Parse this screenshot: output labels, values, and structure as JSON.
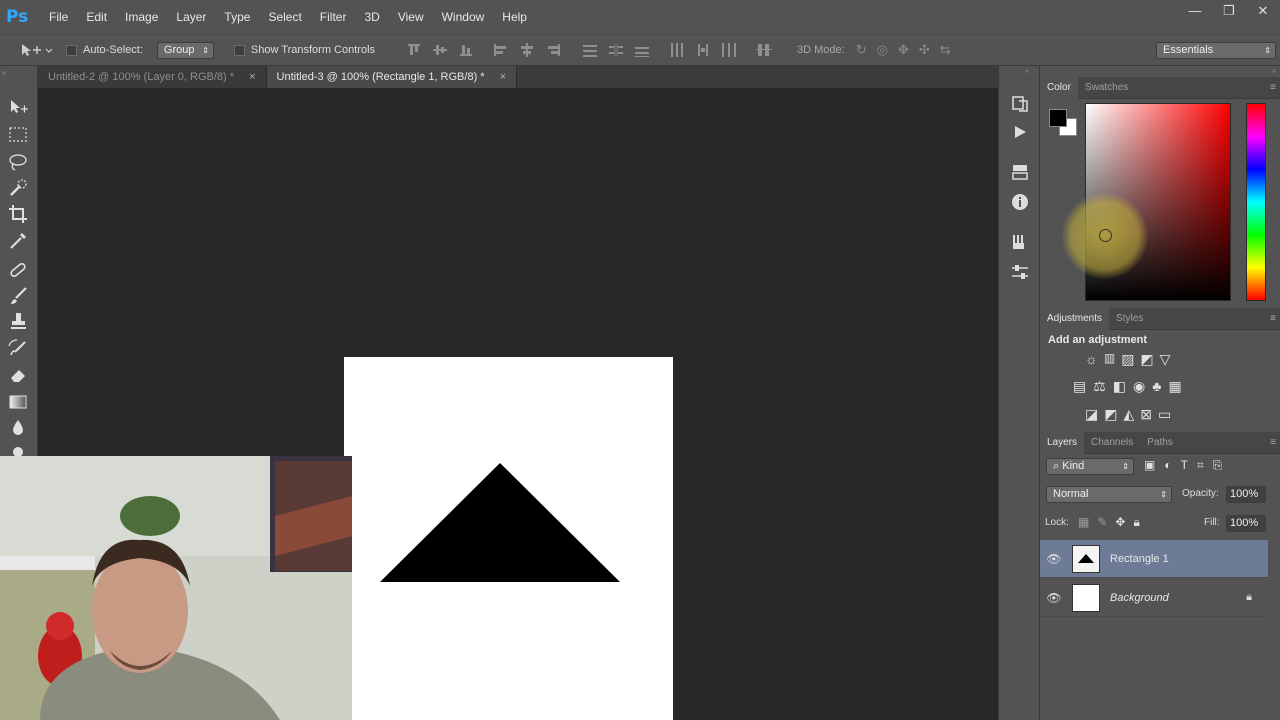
{
  "app": {
    "logo": "Ps"
  },
  "menu": [
    "File",
    "Edit",
    "Image",
    "Layer",
    "Type",
    "Select",
    "Filter",
    "3D",
    "View",
    "Window",
    "Help"
  ],
  "window_controls": {
    "minimize": "—",
    "restore": "❐",
    "close": "✕"
  },
  "options": {
    "auto_select_label": "Auto-Select:",
    "auto_select_value": "Group",
    "transform_label": "Show Transform Controls",
    "mode_3d_label": "3D Mode:",
    "workspace": "Essentials"
  },
  "tabs": [
    {
      "label": "Untitled-2 @ 100% (Layer 0, RGB/8) *",
      "close": "×"
    },
    {
      "label": "Untitled-3 @ 100% (Rectangle 1, RGB/8) *",
      "close": "×"
    }
  ],
  "color_panel": {
    "tabs": [
      "Color",
      "Swatches"
    ]
  },
  "adjustments_panel": {
    "tabs": [
      "Adjustments",
      "Styles"
    ],
    "heading": "Add an adjustment"
  },
  "layers_panel": {
    "tabs": [
      "Layers",
      "Channels",
      "Paths"
    ],
    "filter_kind": "Kind",
    "blend_mode": "Normal",
    "opacity_label": "Opacity:",
    "opacity_value": "100%",
    "lock_label": "Lock:",
    "fill_label": "Fill:",
    "fill_value": "100%",
    "layers": [
      {
        "name": "Rectangle 1",
        "selected": true
      },
      {
        "name": "Background",
        "selected": false,
        "locked": true
      }
    ]
  },
  "colors": {
    "ui_bg": "#535353",
    "canvas": "#282828",
    "selection": "#6d7b97",
    "accent": "#31a8ff"
  }
}
